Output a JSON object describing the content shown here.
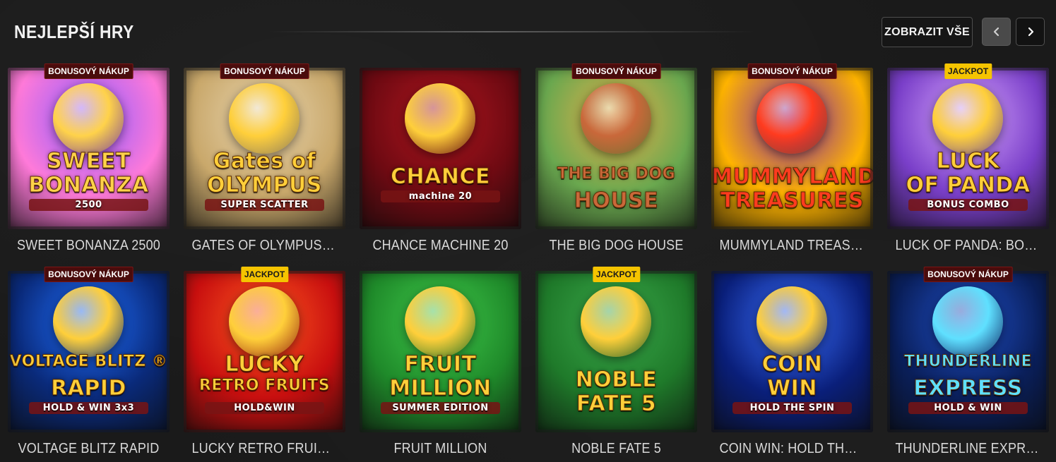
{
  "section": {
    "title": "NEJLEPŠÍ HRY",
    "show_all_label": "ZOBRAZIT VŠE",
    "prev_icon": "chevron-left-icon",
    "next_icon": "chevron-right-icon"
  },
  "badges": {
    "bonus": "BONUSOVÝ NÁKUP",
    "jackpot": "JACKPOT"
  },
  "games": [
    {
      "name": "SWEET BONANZA 2500",
      "badge": "BONUSOVÝ NÁKUP",
      "badge_type": "bonus",
      "logo": [
        "SWEET",
        "BONANZA",
        "2500"
      ],
      "colors": [
        "#ff7ad9",
        "#8a5cff",
        "#ffd24a"
      ]
    },
    {
      "name": "GATES OF OLYMPUS SUPER...",
      "badge": "BONUSOVÝ NÁKUP",
      "badge_type": "bonus",
      "logo": [
        "Gates of",
        "OLYMPUS",
        "SUPER SCATTER"
      ],
      "colors": [
        "#c9a86b",
        "#e8d5b0",
        "#ffcf3a"
      ]
    },
    {
      "name": "CHANCE MACHINE 20",
      "badge": "",
      "badge_type": "",
      "logo": [
        "CHANCE",
        "machine 20"
      ],
      "colors": [
        "#6e0a12",
        "#b0151f",
        "#ffcf3a"
      ]
    },
    {
      "name": "THE BIG DOG HOUSE",
      "badge": "BONUSOVÝ NÁKUP",
      "badge_type": "bonus",
      "logo": [
        "THE BIG DOG",
        "HOUSE"
      ],
      "colors": [
        "#6aa84f",
        "#e8b04a",
        "#c9683a"
      ]
    },
    {
      "name": "MUMMYLAND TREASURES",
      "badge": "BONUSOVÝ NÁKUP",
      "badge_type": "bonus",
      "logo": [
        "MUMMYLAND",
        "TREASURES"
      ],
      "colors": [
        "#ffb400",
        "#7a1fb0",
        "#ff3b1f"
      ]
    },
    {
      "name": "LUCK OF PANDA: BONUS C...",
      "badge": "JACKPOT",
      "badge_type": "jackpot",
      "logo": [
        "LUCK",
        "OF PANDA",
        "BONUS COMBO"
      ],
      "colors": [
        "#7a3fc9",
        "#d9a8ff",
        "#ffcf3a"
      ]
    },
    {
      "name": "VOLTAGE BLITZ RAPID",
      "badge": "BONUSOVÝ NÁKUP",
      "badge_type": "bonus",
      "logo": [
        "VOLTAGE BLITZ ®",
        "RAPID",
        "HOLD & WIN 3x3"
      ],
      "colors": [
        "#0a2a7a",
        "#1f6fff",
        "#ffcf3a"
      ]
    },
    {
      "name": "LUCKY RETRO FRUITS HOL...",
      "badge": "JACKPOT",
      "badge_type": "jackpot",
      "logo": [
        "LUCKY",
        "RETRO FRUITS",
        "HOLD&WIN"
      ],
      "colors": [
        "#c80f0f",
        "#ff5a1f",
        "#ffcf3a"
      ]
    },
    {
      "name": "FRUIT MILLION",
      "badge": "",
      "badge_type": "",
      "logo": [
        "FRUIT",
        "MILLION",
        "SUMMER EDITION"
      ],
      "colors": [
        "#1f8a2a",
        "#3fc94a",
        "#ffcf3a"
      ]
    },
    {
      "name": "NOBLE FATE 5",
      "badge": "JACKPOT",
      "badge_type": "jackpot",
      "logo": [
        "NOBLE",
        "FATE 5"
      ],
      "colors": [
        "#1f7a2a",
        "#3aa84a",
        "#ffcf3a"
      ]
    },
    {
      "name": "COIN WIN: HOLD THE SPIN",
      "badge": "",
      "badge_type": "",
      "logo": [
        "COIN",
        "WIN",
        "HOLD THE SPIN"
      ],
      "colors": [
        "#0a1f7a",
        "#3a6fff",
        "#ffcf3a"
      ]
    },
    {
      "name": "THUNDERLINE EXPRESS: H...",
      "badge": "BONUSOVÝ NÁKUP",
      "badge_type": "bonus",
      "logo": [
        "THUNDERLINE",
        "EXPRESS",
        "HOLD & WIN"
      ],
      "colors": [
        "#0a1f5a",
        "#1f4fc9",
        "#5fe0ff"
      ]
    }
  ]
}
